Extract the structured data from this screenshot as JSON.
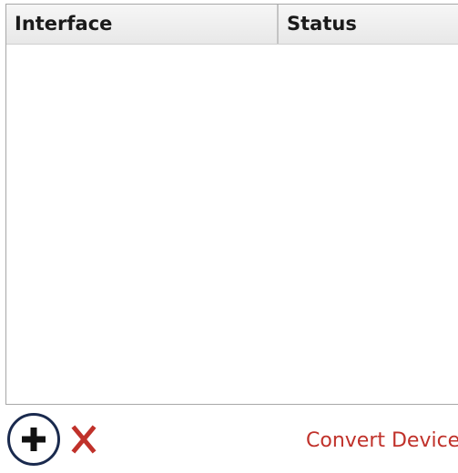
{
  "table": {
    "columns": [
      {
        "label": "Interface"
      },
      {
        "label": "Status"
      }
    ],
    "rows": []
  },
  "toolbar": {
    "add_icon": "plus-icon",
    "remove_icon": "close-x-icon",
    "convert_label": "Convert Devices",
    "colors": {
      "add_ring": "#1a2a4e",
      "remove": "#c0312a",
      "link": "#c0312a"
    }
  }
}
